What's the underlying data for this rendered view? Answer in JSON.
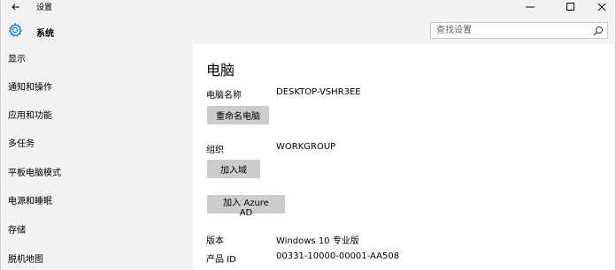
{
  "window": {
    "title": "设置",
    "back_icon": "arrow-left-icon",
    "controls": {
      "minimize_icon": "minimize-icon",
      "maximize_icon": "maximize-icon",
      "close_icon": "close-icon"
    }
  },
  "header": {
    "icon": "gear-icon",
    "section_title": "系统",
    "search_placeholder": "查找设置",
    "search_value": ""
  },
  "sidebar": {
    "items": [
      {
        "label": "显示"
      },
      {
        "label": "通知和操作"
      },
      {
        "label": "应用和功能"
      },
      {
        "label": "多任务"
      },
      {
        "label": "平板电脑模式"
      },
      {
        "label": "电源和睡眠"
      },
      {
        "label": "存储"
      },
      {
        "label": "脱机地图"
      }
    ]
  },
  "main": {
    "page_title": "电脑",
    "pc_name_label": "电脑名称",
    "pc_name_value": "DESKTOP-VSHR3EE",
    "rename_button": "重命名电脑",
    "org_label": "组织",
    "org_value": "WORKGROUP",
    "join_domain_button": "加入域",
    "join_azure_button": "加入 Azure AD",
    "edition_label": "版本",
    "edition_value": "Windows 10 专业版",
    "product_id_label": "产品 ID",
    "product_id_value": "00331-10000-00001-AA508"
  },
  "colors": {
    "accent": "#0078d7",
    "sidebar_bg": "#f2f2f2",
    "content_bg": "#ffffff",
    "button_bg": "#cccccc"
  }
}
